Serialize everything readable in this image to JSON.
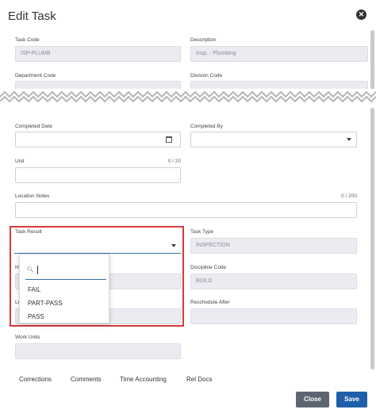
{
  "header": {
    "title": "Edit Task",
    "close_icon": "close-circle-icon"
  },
  "fields": {
    "task_code": {
      "label": "Task Code",
      "value": "ISP-PLUMB"
    },
    "description": {
      "label": "Description",
      "value": "Insp. - Plumbing"
    },
    "department_code": {
      "label": "Department Code",
      "value": ""
    },
    "division_code": {
      "label": "Division Code",
      "value": ""
    },
    "completed_date": {
      "label": "Completed Date",
      "value": ""
    },
    "completed_by": {
      "label": "Completed By",
      "value": ""
    },
    "unit": {
      "label": "Unit",
      "value": "",
      "counter": "0 / 20"
    },
    "location_notes": {
      "label": "Location Notes",
      "value": "",
      "counter": "0 / 200"
    },
    "task_result": {
      "label": "Task Result",
      "value": ""
    },
    "task_type": {
      "label": "Task Type",
      "value": "INSPECTION"
    },
    "hidden_left_1": {
      "label": "H",
      "value": ""
    },
    "discipline_code": {
      "label": "Discipline Code",
      "value": "BUILD"
    },
    "hidden_left_2": {
      "label": "Le",
      "value": ""
    },
    "reschedule_after": {
      "label": "Reschedule After",
      "value": ""
    },
    "work_units": {
      "label": "Work Units",
      "value": ""
    }
  },
  "dropdown": {
    "search_value": "",
    "options": [
      "FAIL",
      "PART-PASS",
      "PASS"
    ]
  },
  "tabs": [
    "Corrections",
    "Comments",
    "Time Accounting",
    "Rel Docs"
  ],
  "buttons": {
    "close": "Close",
    "save": "Save"
  },
  "colors": {
    "primary": "#1f5fa8",
    "highlight_box": "#d83a3a",
    "secondary_button": "#5d6670"
  }
}
